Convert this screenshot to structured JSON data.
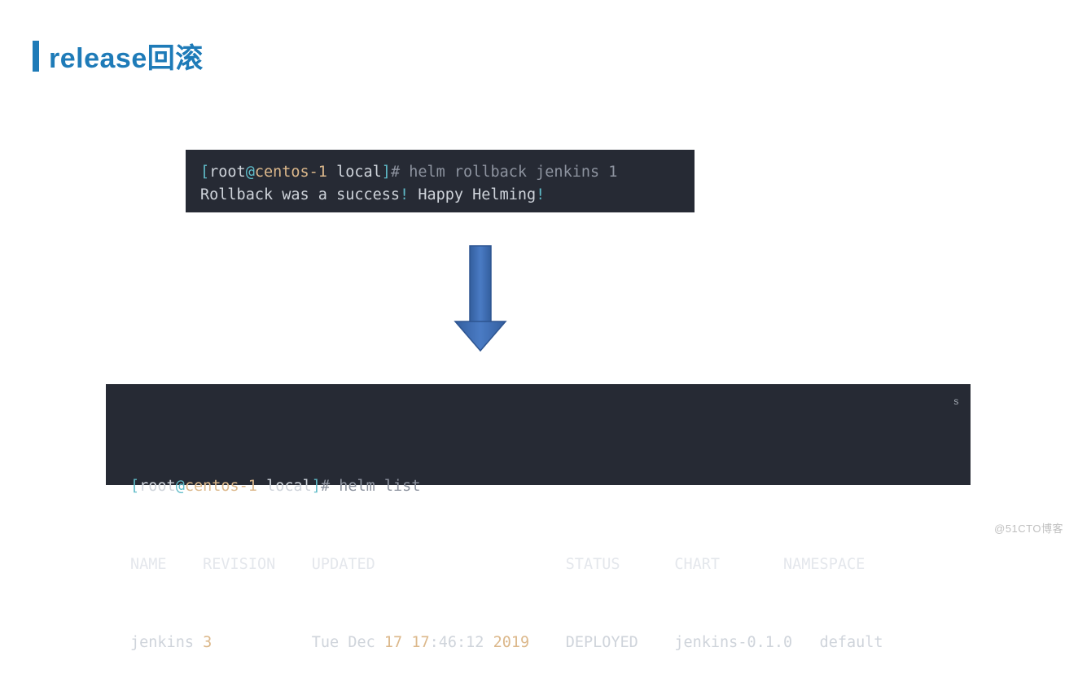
{
  "heading": "release回滚",
  "term1": {
    "prompt": {
      "open": "[",
      "user": "root",
      "at": "@",
      "host": "centos-1",
      "space": " ",
      "path": "local",
      "close": "]",
      "hash": "# "
    },
    "command": "helm rollback jenkins 1",
    "output_pre": "Rollback was a success",
    "bang1": "!",
    "output_mid": " Happy Helming",
    "bang2": "!"
  },
  "arrow": {
    "color": "#3d6fb6"
  },
  "term2": {
    "prompt": {
      "open": "[",
      "user": "root",
      "at": "@",
      "host": "centos-1",
      "space": " ",
      "path": "local",
      "close": "]",
      "hash": "# "
    },
    "command": "helm list",
    "headers": {
      "name": "NAME",
      "revision": "REVISION",
      "updated": "UPDATED",
      "status": "STATUS",
      "chart": "CHART",
      "namespace": "NAMESPACE"
    },
    "row": {
      "name": "jenkins",
      "revision": "3",
      "updated_pre": "Tue Dec ",
      "updated_day": "17",
      "updated_time_h": "17",
      "updated_time_ms": ":46:12 ",
      "updated_year": "2019",
      "status": "DEPLOYED",
      "chart": "jenkins-0.1.0",
      "namespace": "default"
    },
    "tiny": "s"
  },
  "watermark": "@51CTO博客"
}
